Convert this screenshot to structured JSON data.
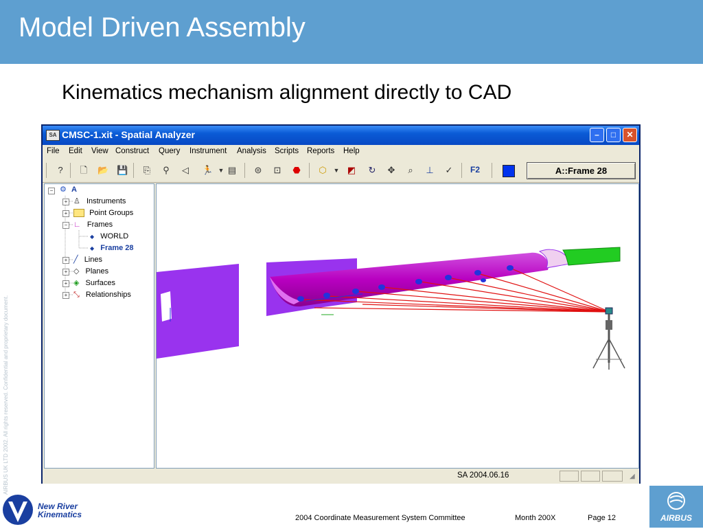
{
  "slide": {
    "title": "Model Driven Assembly",
    "subtitle": "Kinematics mechanism alignment directly to CAD",
    "vertical_note": "AIRBUS UK LTD 2002. All rights reserved. Confidential and proprietary document."
  },
  "window": {
    "title": "CMSC-1.xit - Spatial Analyzer",
    "app_icon_text": "SA",
    "minimize_glyph": "–",
    "maximize_glyph": "□",
    "close_glyph": "✕"
  },
  "menu": [
    "File",
    "Edit",
    "View",
    "Construct",
    "Query",
    "Instrument",
    "Analysis",
    "Scripts",
    "Reports",
    "Help"
  ],
  "toolbar": {
    "f2_label": "F2",
    "active_frame": "A::Frame 28"
  },
  "tree": {
    "root": "A",
    "items": [
      {
        "label": "Instruments",
        "expander": "+"
      },
      {
        "label": "Point Groups",
        "expander": "+"
      },
      {
        "label": "Frames",
        "expander": "−"
      },
      {
        "label": "WORLD",
        "expander": ""
      },
      {
        "label": "Frame 28",
        "expander": ""
      },
      {
        "label": "Lines",
        "expander": "+"
      },
      {
        "label": "Planes",
        "expander": "+"
      },
      {
        "label": "Surfaces",
        "expander": "+"
      },
      {
        "label": "Relationships",
        "expander": "+"
      }
    ]
  },
  "status": {
    "version": "SA 2004.06.16"
  },
  "footer": {
    "logo_line1": "New River",
    "logo_line2": "Kinematics",
    "committee": "2004 Coordinate Measurement System Committee",
    "date": "Month 200X",
    "page": "Page 12",
    "brand": "AIRBUS"
  },
  "colors": {
    "header_blue": "#5e9fd0",
    "cad_purple": "#9933ee",
    "cad_magenta": "#c400c8",
    "tube_green": "#22cc22",
    "laser_red": "#e01010",
    "target_blue": "#2233dd"
  }
}
